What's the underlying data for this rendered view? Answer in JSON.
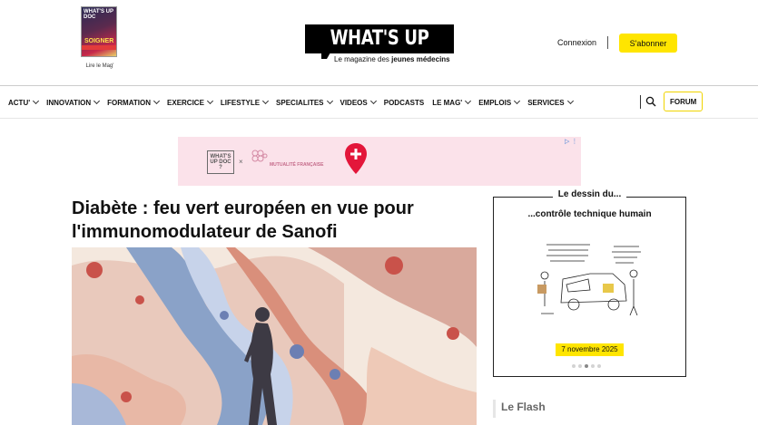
{
  "header": {
    "magazine": {
      "cover_title": "WHAT'S UP DOC",
      "cover_headline": "SOIGNER",
      "label": "Lire le Mag'"
    },
    "logo_text": "WHAT'S UP DOC ?",
    "tagline_prefix": "Le magazine des ",
    "tagline_bold": "jeunes médecins",
    "login_label": "Connexion",
    "subscribe_label": "S'abonner"
  },
  "nav": {
    "items": [
      {
        "label": "ACTU'",
        "dropdown": true
      },
      {
        "label": "INNOVATION",
        "dropdown": true
      },
      {
        "label": "FORMATION",
        "dropdown": true
      },
      {
        "label": "EXERCICE",
        "dropdown": true
      },
      {
        "label": "LIFESTYLE",
        "dropdown": true
      },
      {
        "label": "SPECIALITES",
        "dropdown": true
      },
      {
        "label": "VIDEOS",
        "dropdown": true
      },
      {
        "label": "PODCASTS",
        "dropdown": false
      },
      {
        "label": "LE MAG'",
        "dropdown": true
      },
      {
        "label": "EMPLOIS",
        "dropdown": true
      },
      {
        "label": "SERVICES",
        "dropdown": true
      }
    ],
    "search_icon": "search-icon",
    "forum_label": "FORUM"
  },
  "ad": {
    "logo_text": "WHAT'S UP DOC ?",
    "times": "×",
    "partner_text": "MUTUALITÉ FRANÇAISE",
    "controls": "▷ ⋮",
    "colors": {
      "background": "#fbe2ea",
      "pin": "#e3163a"
    }
  },
  "article": {
    "headline": "Diabète : feu vert européen en vue pour l'immunomodulateur de Sanofi"
  },
  "sidebar": {
    "dessin_title": "Le dessin du...",
    "dessin_subtitle": "...contrôle technique humain",
    "dessin_date": "7 novembre 2025",
    "slides": 5,
    "active_slide": 3,
    "flash_title": "Le Flash"
  },
  "colors": {
    "accent": "#ffe500",
    "text": "#111111"
  }
}
